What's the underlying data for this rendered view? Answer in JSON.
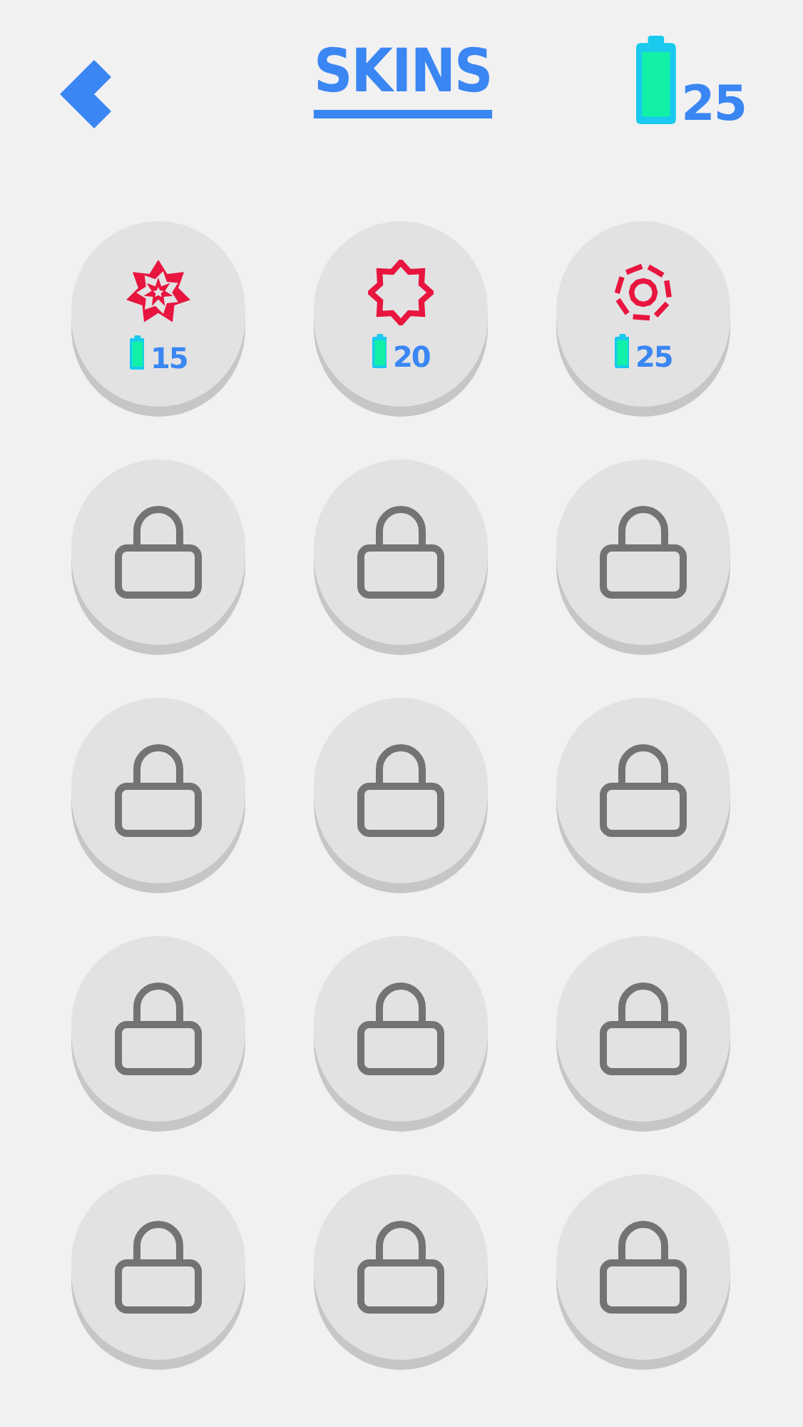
{
  "header": {
    "title": "SKINS",
    "coins": "25"
  },
  "skins": [
    {
      "kind": "rosette",
      "price": "15"
    },
    {
      "kind": "octagram",
      "price": "20"
    },
    {
      "kind": "broken-ring",
      "price": "25"
    },
    {
      "kind": "locked"
    },
    {
      "kind": "locked"
    },
    {
      "kind": "locked"
    },
    {
      "kind": "locked"
    },
    {
      "kind": "locked"
    },
    {
      "kind": "locked"
    },
    {
      "kind": "locked"
    },
    {
      "kind": "locked"
    },
    {
      "kind": "locked"
    },
    {
      "kind": "locked"
    },
    {
      "kind": "locked"
    },
    {
      "kind": "locked"
    }
  ]
}
